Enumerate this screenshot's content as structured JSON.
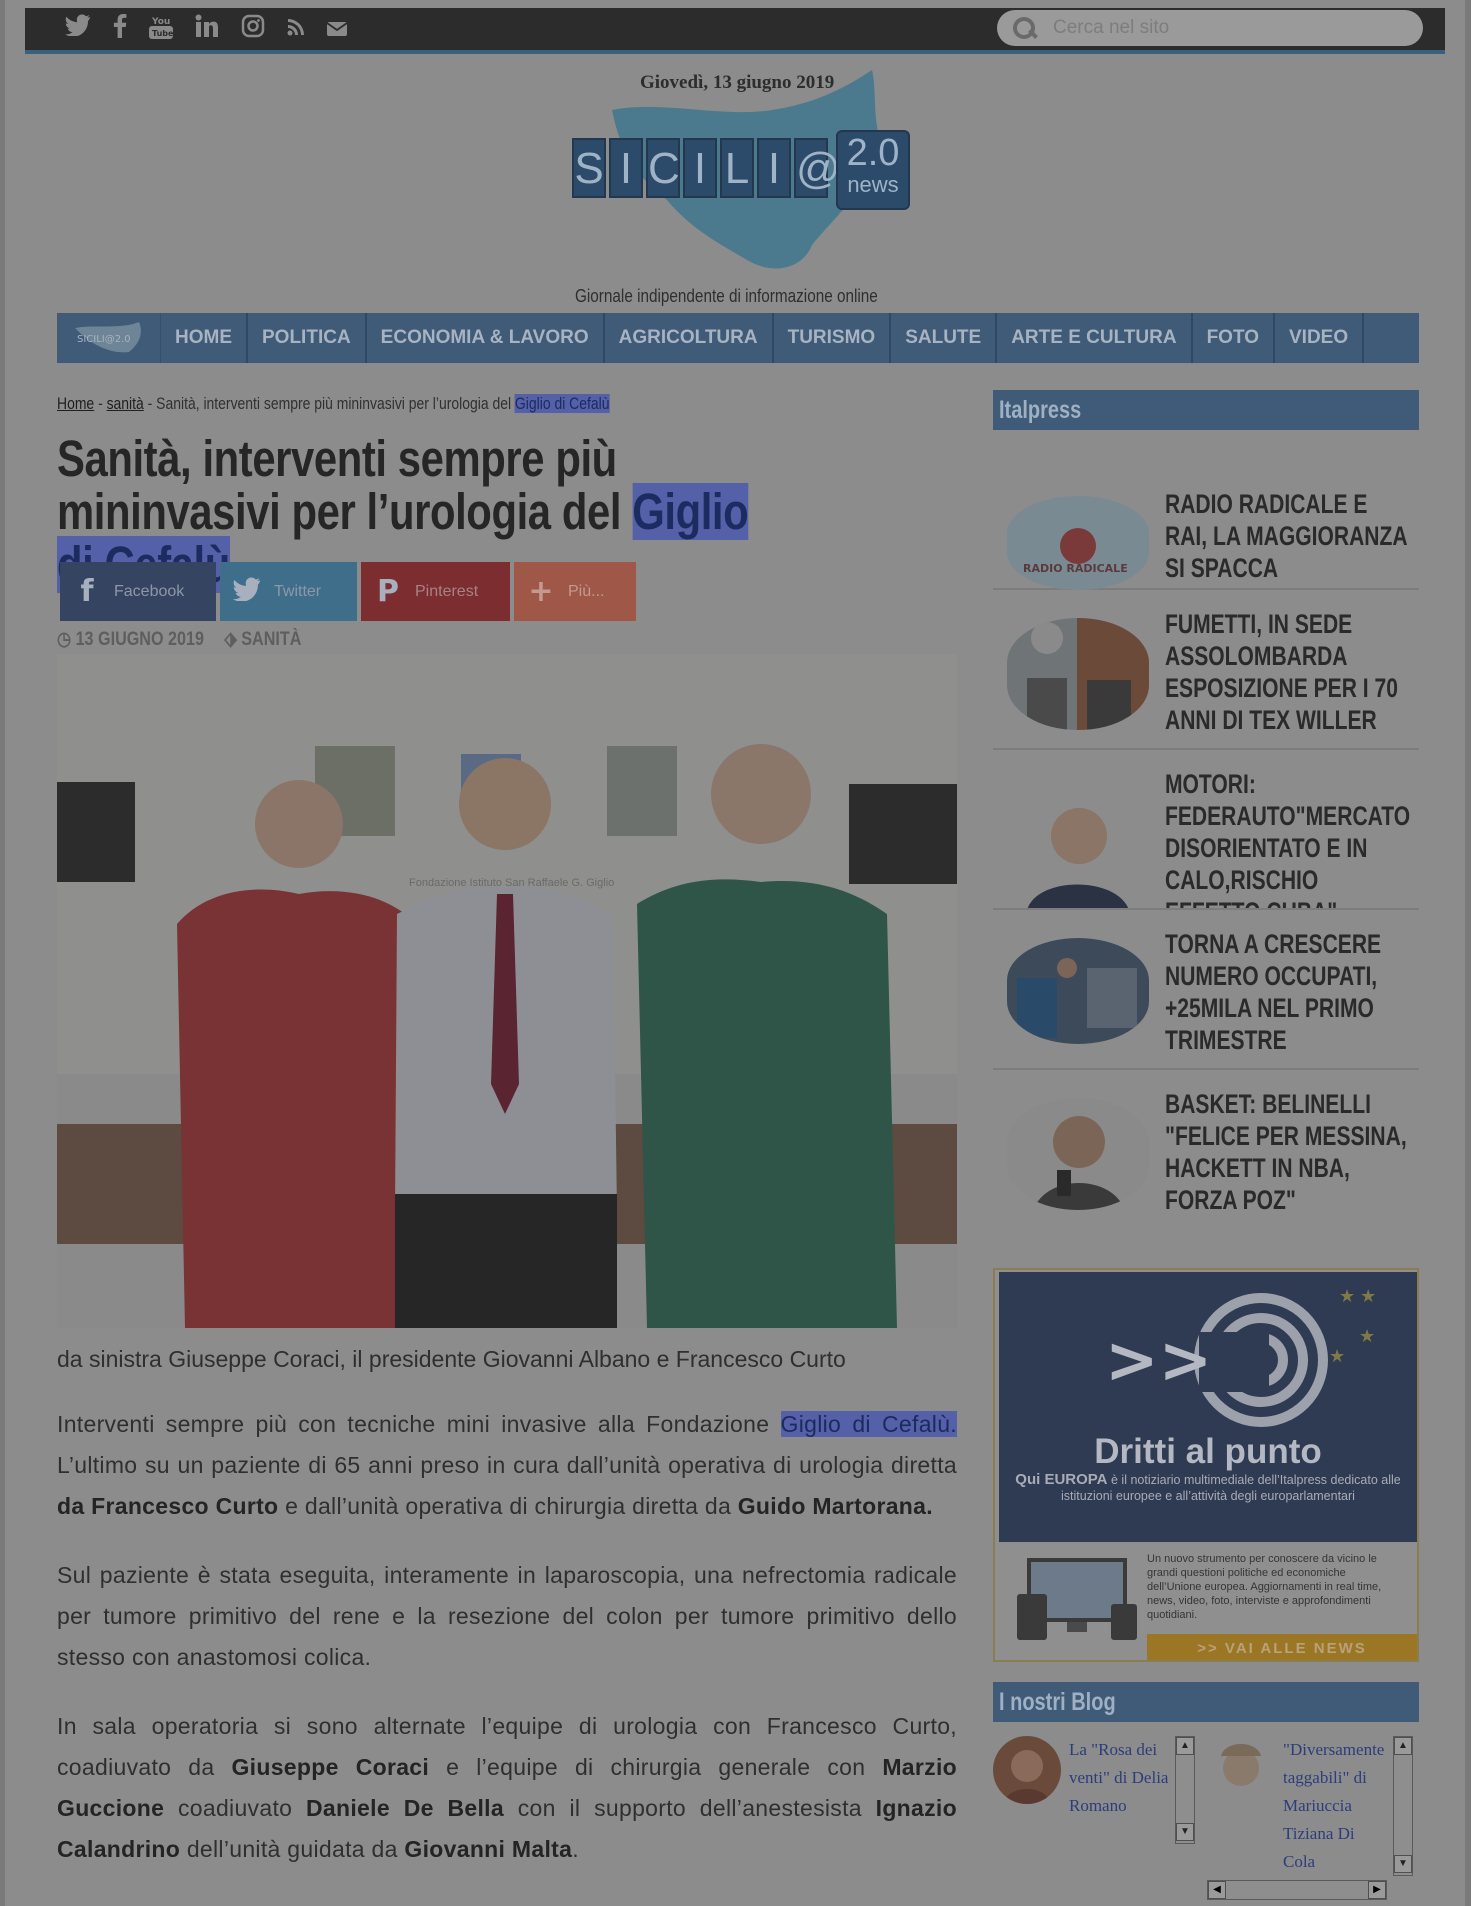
{
  "search": {
    "placeholder": "Cerca nel sito"
  },
  "header": {
    "date": "Giovedì, 13 giugno 2019",
    "logo_text": "SICILI@",
    "logo_badge_top": "2.0",
    "logo_badge_bottom": "news",
    "tagline": "Giornale indipendente di informazione online"
  },
  "nav": {
    "logo_text": "SICILI@2.0",
    "items": [
      "HOME",
      "POLITICA",
      "ECONOMIA & LAVORO",
      "AGRICOLTURA",
      "TURISMO",
      "SALUTE",
      "ARTE E CULTURA",
      "FOTO",
      "VIDEO"
    ]
  },
  "breadcrumb": {
    "home": "Home",
    "sep1": " - ",
    "category": "sanità",
    "sep2": " - Sanità, interventi sempre più mininvasivi per l’urologia del ",
    "highlight": "Giglio di Cefalù"
  },
  "article": {
    "title_part1": "Sanità, interventi sempre più mininvasivi per l’urologia del ",
    "title_highlight": "Giglio di Cefalù",
    "date": "13 GIUGNO 2019",
    "category": "SANITÀ",
    "photo_sign": "Fondazione Istituto San Raffaele G. Giglio",
    "caption": "da sinistra Giuseppe Coraci, il presidente Giovanni Albano e Francesco Curto",
    "p1_a": "Interventi sempre più con tecniche mini invasive alla Fondazione ",
    "p1_hl": "Giglio di Cefalù.",
    "p1_b": " L’ultimo su un paziente di 65 anni preso in cura dall’unità operativa di urologia diretta ",
    "p1_bold1": "da Francesco Curto",
    "p1_c": "  e dall’unità operativa di chirurgia diretta da ",
    "p1_bold2": "Guido Martorana.",
    "p2": "Sul paziente è stata eseguita, interamente in laparoscopia, una nefrectomia radicale per tumore primitivo del rene e la resezione del colon per tumore primitivo dello stesso con anastomosi colica.",
    "p3_a": "In sala operatoria si sono alternate l’equipe di urologia con Francesco Curto, coadiuvato da ",
    "p3_b1": "Giuseppe Coraci",
    "p3_b": "  e l’equipe di chirurgia generale con ",
    "p3_b2": "Marzio Guccione",
    "p3_c": "  coadiuvato ",
    "p3_b3": "Daniele De Bella",
    "p3_d": "  con il supporto dell’anestesista ",
    "p3_b4": "Ignazio Calandrino",
    "p3_e": " dell’unità guidata da ",
    "p3_b5": "Giovanni Malta",
    "p3_f": "."
  },
  "share": {
    "facebook": "Facebook",
    "twitter": "Twitter",
    "pinterest": "Pinterest",
    "more": "Più..."
  },
  "sidebar": {
    "italpress_title": "Italpress",
    "news": [
      {
        "title": "RADIO RADICALE E RAI, LA MAGGIORANZA SI SPACCA",
        "thumb_text": "RADIO RADICALE"
      },
      {
        "title": "FUMETTI, IN SEDE ASSOLOMBARDA ESPOSIZIONE PER I 70 ANNI DI TEX WILLER"
      },
      {
        "title": "MOTORI: FEDERAUTO\"MERCATO DISORIENTATO E IN CALO,RISCHIO EFFETTO CUBA\""
      },
      {
        "title": "TORNA A CRESCERE NUMERO OCCUPATI, +25MILA NEL PRIMO TRIMESTRE"
      },
      {
        "title": "BASKET: BELINELLI \"FELICE PER MESSINA, HACKETT IN NBA, FORZA POZ\""
      }
    ],
    "banner": {
      "arrows": ">>",
      "title": "Dritti al punto",
      "qui_bold": "Qui EUROPA",
      "qui_rest": " è il notiziario multimediale dell’Italpress dedicato alle istituzioni europee e all’attività degli europarlamentari",
      "desc": "Un nuovo strumento per conoscere da vicino le grandi questioni politiche ed economiche dell’Unione europea. Aggiornamenti in real time, news, video, foto, interviste e approfondimenti quotidiani.",
      "cta": ">> VAI ALLE NEWS"
    },
    "blogs_title": "I nostri Blog",
    "blogs": [
      {
        "title": "La \"Rosa dei venti\" di Delia Romano"
      },
      {
        "title": "\"Diversamente taggabili\" di Mariuccia Tiziana Di Cola"
      }
    ]
  },
  "colors": {
    "nav": "#3f5b78",
    "highlight": "#5460a7",
    "topbar": "#2c2c2c"
  }
}
